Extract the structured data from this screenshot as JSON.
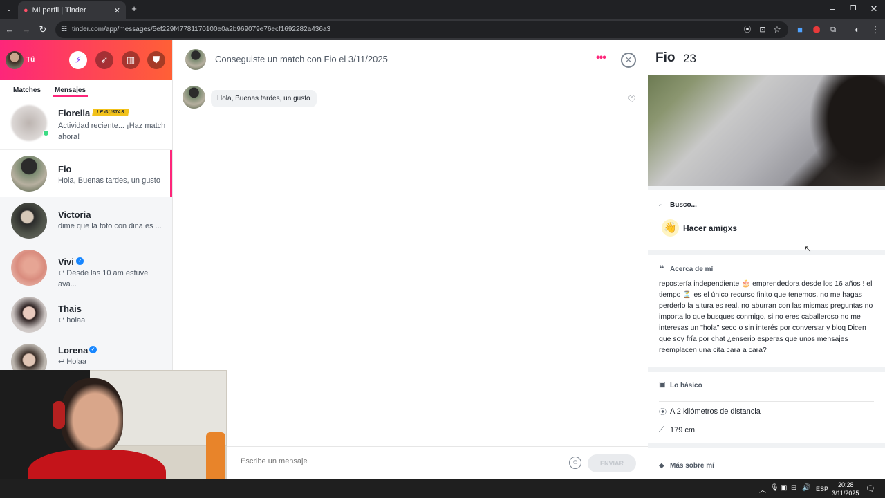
{
  "browser": {
    "tab_title": "Mi perfil | Tinder",
    "url": "tinder.com/app/messages/5ef229f47781170100e0a2b969079e76ecf1692282a436a3"
  },
  "sidebar": {
    "user_label": "Tú",
    "tabs": [
      "Matches",
      "Mensajes"
    ],
    "conversations": [
      {
        "name": "Fiorella",
        "badge": "LE GUSTAS",
        "preview": "Actividad reciente... ¡Haz match ahora!"
      },
      {
        "name": "Fio",
        "preview": "Hola, Buenas tardes, un gusto"
      },
      {
        "name": "Victoria",
        "preview": "dime que la foto con dina es ..."
      },
      {
        "name": "Vivi",
        "preview": "↩ Desde las 10 am estuve ava..."
      },
      {
        "name": "Thais",
        "preview": "↩ holaa"
      },
      {
        "name": "Lorena",
        "preview": "↩ Holaa"
      }
    ]
  },
  "chat": {
    "header": "Conseguiste un match con Fio el 3/11/2025",
    "message": "Hola, Buenas tardes, un gusto",
    "input_placeholder": "Escribe un mensaje",
    "send_label": "ENVIAR"
  },
  "profile": {
    "name": "Fio",
    "age": "23",
    "looking_label": "Busco...",
    "looking_value": "Hacer amigxs",
    "about_title": "Acerca de mí",
    "about_text": "repostería independiente 🎂 emprendedora desde los 16 años ! el tiempo ⏳ es el único recurso finito que tenemos, no me hagas perderlo la altura es real, no aburran con las mismas preguntas no importa lo que busques conmigo, si no eres caballeroso no me interesas un \"hola\" seco o sin interés por conversar y bloq Dicen que soy fría por chat ¿enserio esperas que unos mensajes reemplacen una cita cara a cara?",
    "basics_title": "Lo básico",
    "distance": "A 2 kilómetros de distancia",
    "height": "179 cm",
    "more_title": "Más sobre mí"
  },
  "taskbar": {
    "lang": "ESP",
    "time": "20:28",
    "date": "3/11/2025"
  },
  "colors": {
    "accent": "#fd267a",
    "accent2": "#ff6036",
    "badge": "#f2c21b",
    "online": "#3ddc84",
    "verified": "#1786ff"
  }
}
